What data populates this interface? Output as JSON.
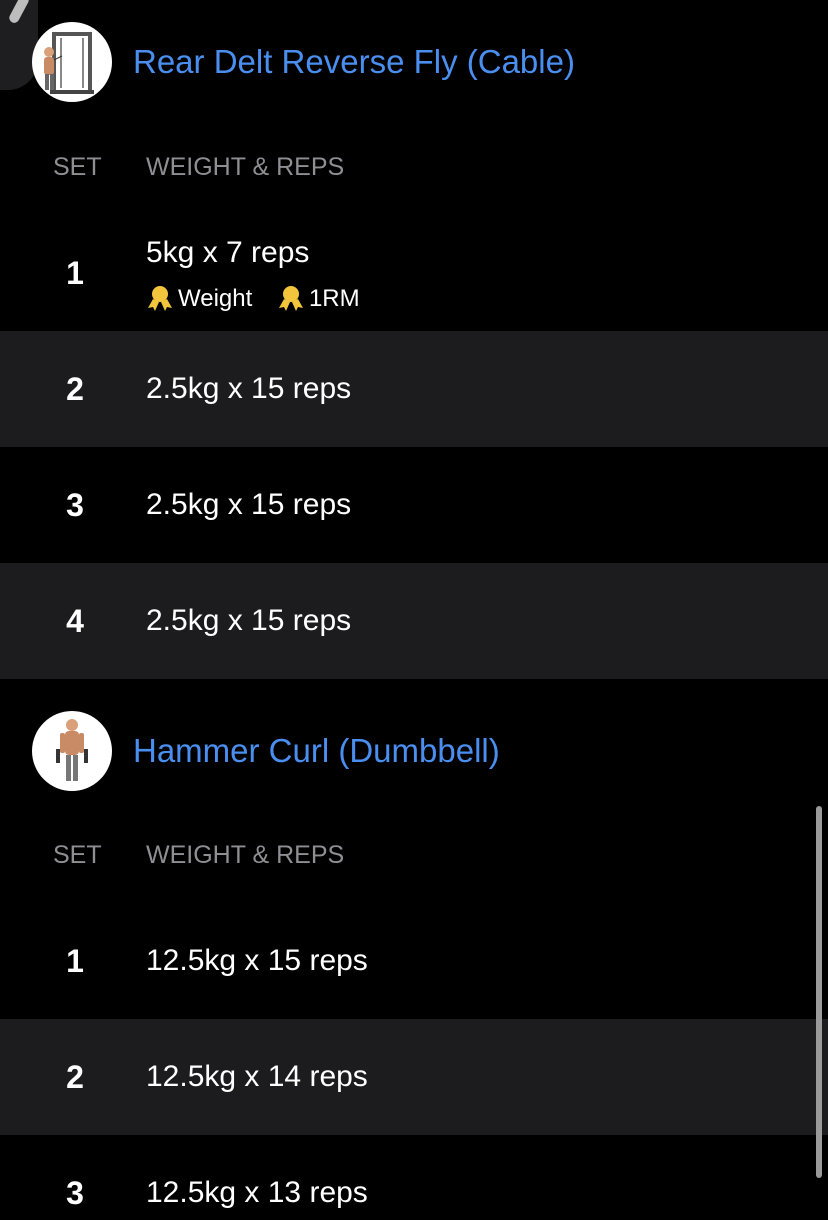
{
  "exercises": [
    {
      "title": "Rear Delt Reverse Fly (Cable)",
      "icon": "cable-machine-exercise-thumbnail",
      "columns": {
        "set": "SET",
        "weight_reps": "WEIGHT & REPS"
      },
      "sets": [
        {
          "number": "1",
          "text": "5kg x 7 reps",
          "badges": [
            "Weight",
            "1RM"
          ]
        },
        {
          "number": "2",
          "text": "2.5kg x 15 reps"
        },
        {
          "number": "3",
          "text": "2.5kg x 15 reps"
        },
        {
          "number": "4",
          "text": "2.5kg x 15 reps"
        }
      ]
    },
    {
      "title": "Hammer Curl (Dumbbell)",
      "icon": "dumbbell-exercise-thumbnail",
      "columns": {
        "set": "SET",
        "weight_reps": "WEIGHT & REPS"
      },
      "sets": [
        {
          "number": "1",
          "text": "12.5kg x 15 reps"
        },
        {
          "number": "2",
          "text": "12.5kg x 14 reps"
        },
        {
          "number": "3",
          "text": "12.5kg x 13 reps"
        }
      ]
    }
  ],
  "colors": {
    "accent": "#4a8ff0",
    "background": "#000000",
    "row_alt": "#1c1c1e",
    "muted": "#8e8e93",
    "medal": "#f2c53d"
  }
}
